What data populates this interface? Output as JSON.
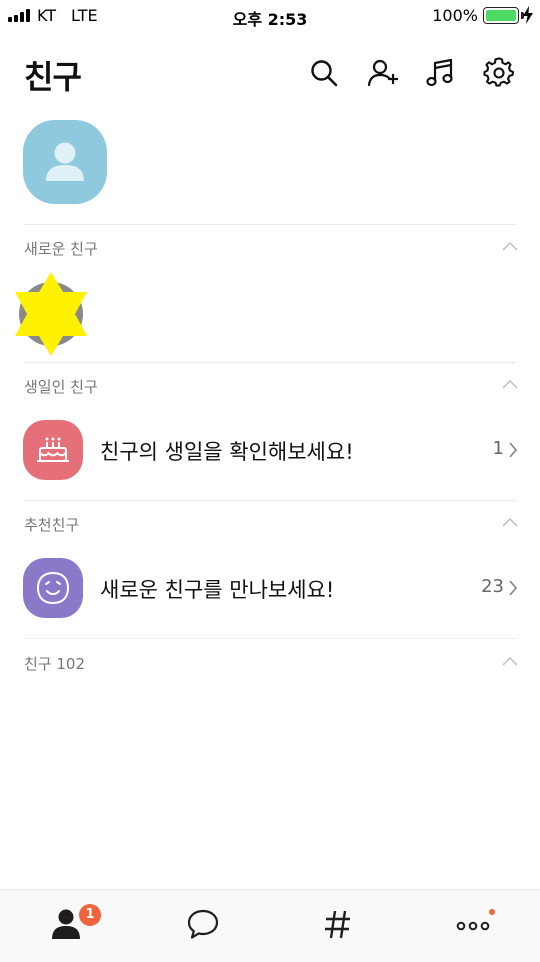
{
  "status_bar": {
    "carrier": "KT",
    "network": "LTE",
    "time": "오후 2:53",
    "battery_percent": "100%",
    "battery_level": 1.0,
    "battery_color": "#4cd964"
  },
  "header": {
    "title": "친구",
    "actions": [
      {
        "icon": "search-icon"
      },
      {
        "icon": "add-friend-icon"
      },
      {
        "icon": "music-icon"
      },
      {
        "icon": "settings-icon"
      }
    ]
  },
  "sections": {
    "new_friends": {
      "title": "새로운 친구"
    },
    "birthday": {
      "title": "생일인 친구"
    },
    "recommended": {
      "title": "추천친구"
    },
    "friends": {
      "title": "친구 102"
    }
  },
  "rows": {
    "birthday": {
      "label": "친구의 생일을 확인해보세요!",
      "count": "1",
      "icon_color": "#e5707a"
    },
    "recommended": {
      "label": "새로운 친구를 만나보세요!",
      "count": "23",
      "icon_color": "#8a79c9"
    }
  },
  "tabbar": {
    "tabs": [
      {
        "icon": "friends-tab-icon",
        "badge": "1"
      },
      {
        "icon": "chat-tab-icon"
      },
      {
        "icon": "hashtag-tab-icon"
      },
      {
        "icon": "more-tab-icon"
      }
    ],
    "badge_color": "#f0643c"
  },
  "colors": {
    "profile_bg": "#8ec9dd",
    "divider": "#ececec",
    "section_title": "#777777"
  }
}
